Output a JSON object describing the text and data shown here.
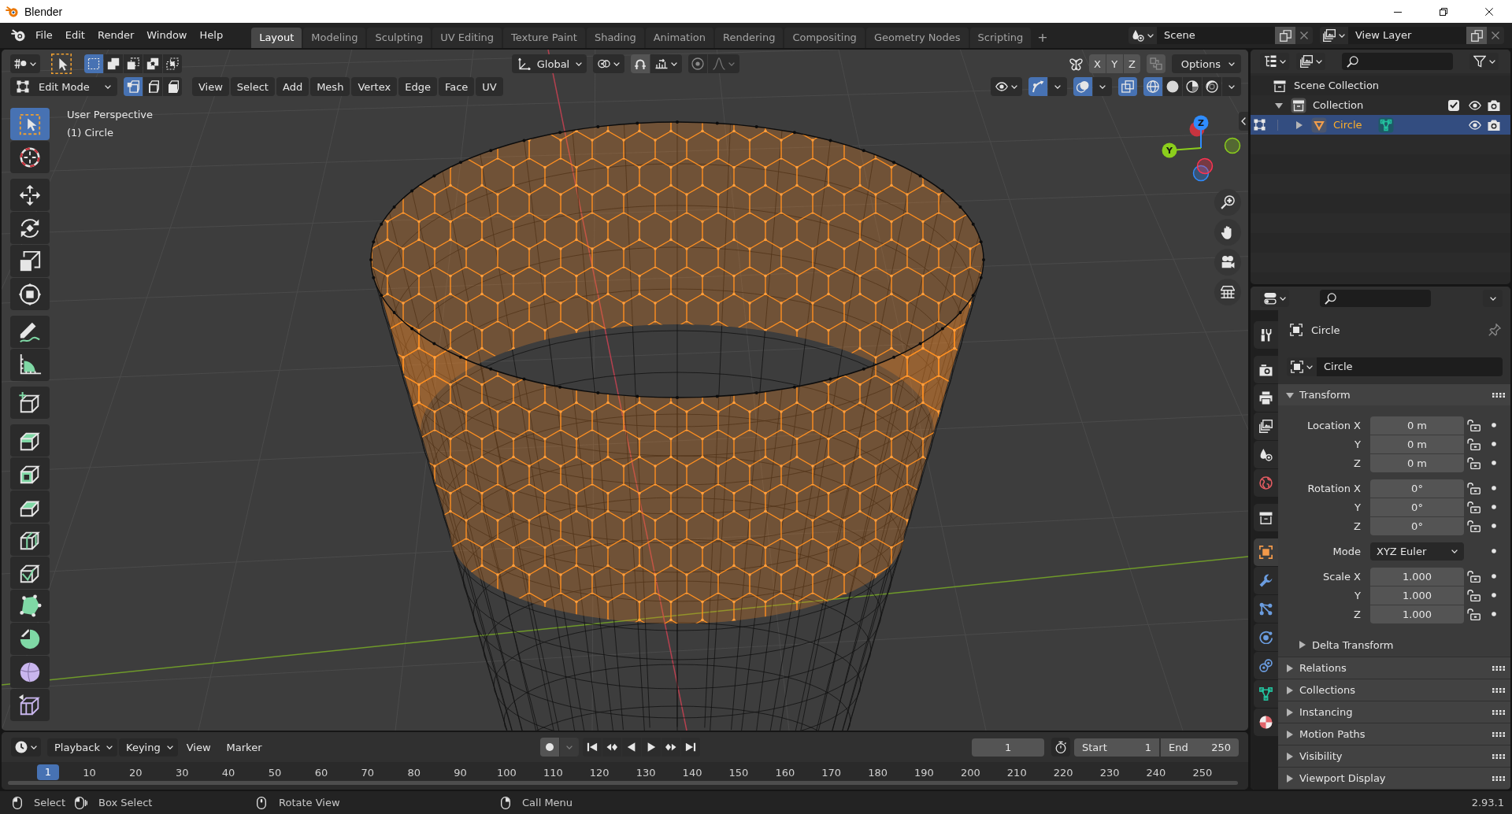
{
  "window": {
    "title": "Blender"
  },
  "top_bar": {
    "menus": [
      "File",
      "Edit",
      "Render",
      "Window",
      "Help"
    ],
    "workspaces": [
      {
        "label": "Layout",
        "selected": true
      },
      {
        "label": "Modeling",
        "selected": false
      },
      {
        "label": "Sculpting",
        "selected": false
      },
      {
        "label": "UV Editing",
        "selected": false
      },
      {
        "label": "Texture Paint",
        "selected": false
      },
      {
        "label": "Shading",
        "selected": false
      },
      {
        "label": "Animation",
        "selected": false
      },
      {
        "label": "Rendering",
        "selected": false
      },
      {
        "label": "Compositing",
        "selected": false
      },
      {
        "label": "Geometry Nodes",
        "selected": false
      },
      {
        "label": "Scripting",
        "selected": false
      }
    ],
    "add_workspace": "+",
    "scene": "Scene",
    "view_layer": "View Layer"
  },
  "viewport": {
    "tool_header": {
      "box_modes": [
        {
          "selected": true
        },
        {
          "selected": false
        },
        {
          "selected": false
        },
        {
          "selected": false
        },
        {
          "selected": false
        }
      ],
      "orientation": "Global",
      "proportional_editing": false,
      "mirror_axes": [
        {
          "label": "X",
          "on": false
        },
        {
          "label": "Y",
          "on": false
        },
        {
          "label": "Z",
          "on": false
        }
      ],
      "options": "Options"
    },
    "header": {
      "mode": "Edit Mode",
      "select_modes": [
        {
          "selected": true
        },
        {
          "selected": false
        },
        {
          "selected": false
        }
      ],
      "menus": [
        "View",
        "Select",
        "Add",
        "Mesh",
        "Vertex",
        "Edge",
        "Face",
        "UV"
      ],
      "gizmos": true,
      "overlays": true,
      "xray": true,
      "shading_modes": [
        {
          "selected": true
        },
        {
          "selected": false
        },
        {
          "selected": false
        },
        {
          "selected": false
        }
      ]
    },
    "info": [
      "User Perspective",
      "(1) Circle"
    ],
    "tool_groups": [
      [
        {
          "kind": "select",
          "selected": true
        },
        {
          "kind": "cursor",
          "selected": false
        }
      ],
      [
        {
          "kind": "move",
          "selected": false
        },
        {
          "kind": "rotate",
          "selected": false
        },
        {
          "kind": "scale",
          "selected": false
        },
        {
          "kind": "transform",
          "selected": false
        }
      ],
      [
        {
          "kind": "annotate",
          "selected": false
        },
        {
          "kind": "measure",
          "selected": false
        }
      ],
      [
        {
          "kind": "add_cube",
          "selected": false
        }
      ],
      [
        {
          "kind": "extrude",
          "selected": false
        },
        {
          "kind": "inset",
          "selected": false
        },
        {
          "kind": "bevel",
          "selected": false
        },
        {
          "kind": "loop_cut",
          "selected": false
        },
        {
          "kind": "knife",
          "selected": false
        },
        {
          "kind": "poly_build",
          "selected": false
        },
        {
          "kind": "spin",
          "selected": false
        },
        {
          "kind": "smooth",
          "selected": false
        },
        {
          "kind": "edge_slide",
          "selected": false
        }
      ]
    ],
    "gizmo": {
      "axes": [
        {
          "label": "Z",
          "color": "#2f8cff"
        },
        {
          "label": "Y",
          "color": "#8bce1c"
        }
      ]
    }
  },
  "outliner": {
    "items": [
      {
        "label": "Scene Collection",
        "kind": "scene_collection",
        "selected": false,
        "children": [
          {
            "label": "Collection",
            "kind": "collection",
            "selected": false,
            "expanded": true,
            "checked": true,
            "children": [
              {
                "label": "Circle",
                "kind": "object",
                "selected": true,
                "expanded": false
              }
            ]
          }
        ]
      }
    ]
  },
  "properties": {
    "tab_groups": [
      [
        {
          "kind": "tool",
          "selected": false
        }
      ],
      [
        {
          "kind": "render",
          "selected": false
        },
        {
          "kind": "output",
          "selected": false
        },
        {
          "kind": "view_layer",
          "selected": false
        },
        {
          "kind": "scene",
          "selected": false
        },
        {
          "kind": "world",
          "selected": false
        }
      ],
      [
        {
          "kind": "collection",
          "selected": false
        }
      ],
      [
        {
          "kind": "object",
          "selected": true
        },
        {
          "kind": "modifiers",
          "selected": false
        },
        {
          "kind": "particles",
          "selected": false
        },
        {
          "kind": "physics",
          "selected": false
        },
        {
          "kind": "constraints",
          "selected": false
        },
        {
          "kind": "data",
          "selected": false
        },
        {
          "kind": "material",
          "selected": false
        }
      ]
    ],
    "context": "Circle",
    "name": "Circle",
    "transform": {
      "title": "Transform",
      "expanded": true,
      "groups": [
        [
          {
            "kind": "number",
            "label": "Location X",
            "value": "0 m"
          },
          {
            "kind": "number",
            "label": "Y",
            "value": "0 m"
          },
          {
            "kind": "number",
            "label": "Z",
            "value": "0 m"
          }
        ],
        [
          {
            "kind": "number",
            "label": "Rotation X",
            "value": "0°"
          },
          {
            "kind": "number",
            "label": "Y",
            "value": "0°"
          },
          {
            "kind": "number",
            "label": "Z",
            "value": "0°"
          }
        ],
        [
          {
            "kind": "dropdown",
            "label": "Mode",
            "value": "XYZ Euler"
          }
        ],
        [
          {
            "kind": "number",
            "label": "Scale X",
            "value": "1.000"
          },
          {
            "kind": "number",
            "label": "Y",
            "value": "1.000"
          },
          {
            "kind": "number",
            "label": "Z",
            "value": "1.000"
          }
        ]
      ],
      "subpanels": [
        {
          "title": "Delta Transform",
          "expanded": false
        }
      ]
    },
    "panels": [
      {
        "title": "Relations",
        "expanded": false
      },
      {
        "title": "Collections",
        "expanded": false
      },
      {
        "title": "Instancing",
        "expanded": false
      },
      {
        "title": "Motion Paths",
        "expanded": false
      },
      {
        "title": "Visibility",
        "expanded": false
      },
      {
        "title": "Viewport Display",
        "expanded": false
      }
    ]
  },
  "timeline": {
    "menus": [
      {
        "label": "Playback",
        "kind": "dropdown"
      },
      {
        "label": "Keying",
        "kind": "dropdown"
      },
      {
        "label": "View",
        "kind": "menu"
      },
      {
        "label": "Marker",
        "kind": "menu"
      }
    ],
    "auto_keying": false,
    "current_frame": "1",
    "preview_range": false,
    "start_label": "Start",
    "start": "1",
    "end_label": "End",
    "end": "250",
    "playhead": "1",
    "ruler": [
      "10",
      "20",
      "30",
      "40",
      "50",
      "60",
      "70",
      "80",
      "90",
      "100",
      "110",
      "120",
      "130",
      "140",
      "150",
      "160",
      "170",
      "180",
      "190",
      "200",
      "210",
      "220",
      "230",
      "240",
      "250"
    ]
  },
  "status_bar": {
    "hints": [
      {
        "kind": "left_click",
        "label": "Select"
      },
      {
        "kind": "left_drag",
        "label": "Box Select"
      },
      {
        "kind": "middle_click",
        "label": "Rotate View"
      },
      {
        "kind": "right_click",
        "label": "Call Menu"
      }
    ],
    "version": "2.93.1"
  }
}
